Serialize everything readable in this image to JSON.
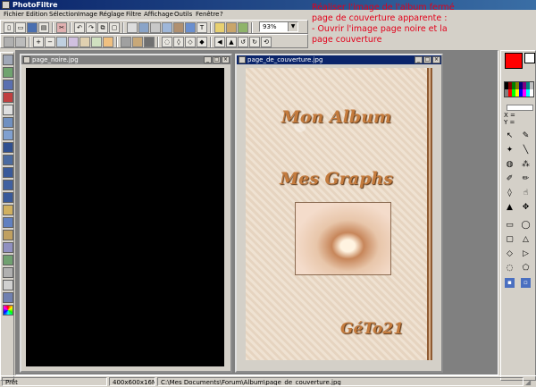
{
  "app": {
    "title": "PhotoFiltre"
  },
  "menu": [
    "Fichier",
    "Edition",
    "Sélection",
    "Image",
    "Réglage",
    "Filtre",
    "Affichage",
    "Outils",
    "Fenêtre",
    "?"
  ],
  "toolbar": {
    "zoom": "93%"
  },
  "note": {
    "line1": "Réaliser l'image de l'album fermé",
    "line2": "page de couverture apparente :",
    "line3": "- Ouvrir l'image page noire et la",
    "line4": "page couverture"
  },
  "windows": {
    "black": {
      "title": "page_noire.jpg"
    },
    "cover": {
      "title": "page_de_couverture.jpg"
    }
  },
  "cover": {
    "title1": "Mon Album",
    "title2": "Mes Graphs",
    "signature": "GéTo21"
  },
  "palette": {
    "foreground": "#ff0000",
    "background": "#ffffff",
    "coord_x": "X =",
    "coord_y": "Y ="
  },
  "status": {
    "ready": "Prêt",
    "size": "400x600x16M",
    "path": "C:\\Mes Documents\\Forum\\Album\\page_de_couverture.jpg"
  }
}
